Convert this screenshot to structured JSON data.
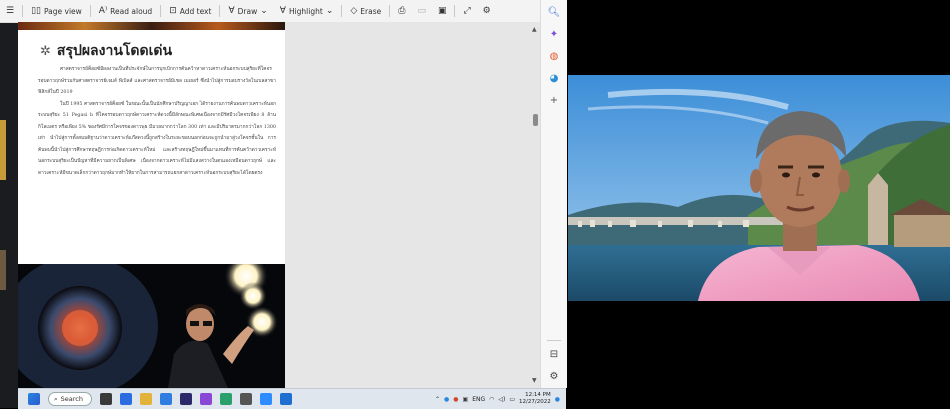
{
  "toolbar": {
    "page_view": "Page view",
    "read_aloud": "Read aloud",
    "add_text": "Add text",
    "draw": "Draw",
    "highlight": "Highlight",
    "erase": "Erase"
  },
  "document": {
    "title": "สรุปผลงานโดดเด่น",
    "paragraphs": [
      "ศาสตราจารย์ค็อยซ์มีผลงานเป็นที่ประจักษ์ในการบุกเบิกการค้นคว้าหาดาวเคราะห์นอกระบบสุริยะที่โคจรรอบดาวฤกษ์ร่วมกับศาสตราจารย์เจมส์ พีเบิลส์ และศาสตราจารย์มิเชล เมเยอร์ ซึ่งนำไปสู่การมอบรางวัลโนเบลสาขาฟิสิกส์ในปี 2019",
      "ในปี 1995 ศาสตราจารย์ค็อยซ์ ในขณะนั้นเป็นนักศึกษาปริญญาเอก ได้รายงานการค้นพบดาวเคราะห์นอกระบบสุริยะ 51 Pegasi b ที่โคจรรอบดาวฤกษ์ดาวเคราะห์ดวงนี้มีลักษณะพิเศษเนื่องจากมีรัศมีวงโคจรเพียง 8 ล้านกิโลเมตร หรือเพียง 5% ของรัศมีการโคจรของดาวพุธ มีมวลมากกว่าโลก 300 เท่า และมีปริมาตรมากกว่าโลก 1300 เท่า นำไปสู่การตั้งสมมติฐานว่าดาวเคราะห์แก๊สดวงนี้ถูกสร้างในระยะขอบนอกก่อนจะถูกนำมาสู่วงโคจรชั้นใน การค้นพบนี้นำไปสู่การศึกษาทฤษฎีการก่อเกิดดาวเคราะห์ใหม่ และสร้างทฤษฎีใหม่ขึ้นมาแทนที่การค้นคว้าดาวเคราะห์นอกระบบสุริยะเป็นปัญหาที่มีความยากเป็นพิเศษ เนื่องจากดาวเคราะห์ไม่มีแสงสว่างในตนเองเหมือนดาวฤกษ์ และดาวเคราะห์มีขนาดเล็กกว่าดาวฤกษ์มากทำให้ยากในการสามารถแยกสาดาวเคราะห์นอกระบบสุริยะได้โดยตรง"
    ]
  },
  "taskbar": {
    "search_label": "Search",
    "lang": "ENG",
    "time": "12:14 PM",
    "date": "12/27/2022"
  },
  "colors": {
    "accent": "#2a6fd6",
    "toolbar_bg": "#f3f3f3",
    "video_shirt": "#f1a8c8"
  }
}
